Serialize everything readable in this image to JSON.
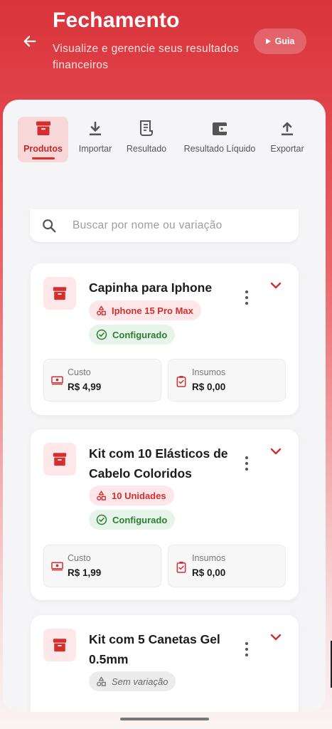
{
  "header": {
    "title": "Fechamento",
    "subtitle": "Visualize e gerencie seus resultados financeiros",
    "guide_label": "Guia"
  },
  "tabs": [
    {
      "label": "Produtos",
      "icon": "archive-icon",
      "active": true
    },
    {
      "label": "Importar",
      "icon": "download-icon",
      "active": false
    },
    {
      "label": "Resultado",
      "icon": "receipt-icon",
      "active": false
    },
    {
      "label": "Resultado Líquido",
      "icon": "wallet-icon",
      "active": false
    },
    {
      "label": "Exportar",
      "icon": "upload-icon",
      "active": false
    }
  ],
  "search": {
    "placeholder": "Buscar por nome ou variação"
  },
  "products": [
    {
      "name": "Capinha para Iphone",
      "variation": "Iphone 15 Pro Max",
      "status": "Configurado",
      "cost_label": "Custo",
      "cost_value": "R$ 4,99",
      "inputs_label": "Insumos",
      "inputs_value": "R$ 0,00"
    },
    {
      "name": "Kit com 10 Elásticos de Cabelo Coloridos",
      "variation": "10 Unidades",
      "status": "Configurado",
      "cost_label": "Custo",
      "cost_value": "R$ 1,99",
      "inputs_label": "Insumos",
      "inputs_value": "R$ 0,00"
    },
    {
      "name": "Kit com 5 Canetas Gel 0.5mm",
      "variation": "Sem variação"
    }
  ],
  "colors": {
    "brand": "#d9333b",
    "accent_red": "#d32f2f",
    "success_green": "#2e7d32"
  }
}
